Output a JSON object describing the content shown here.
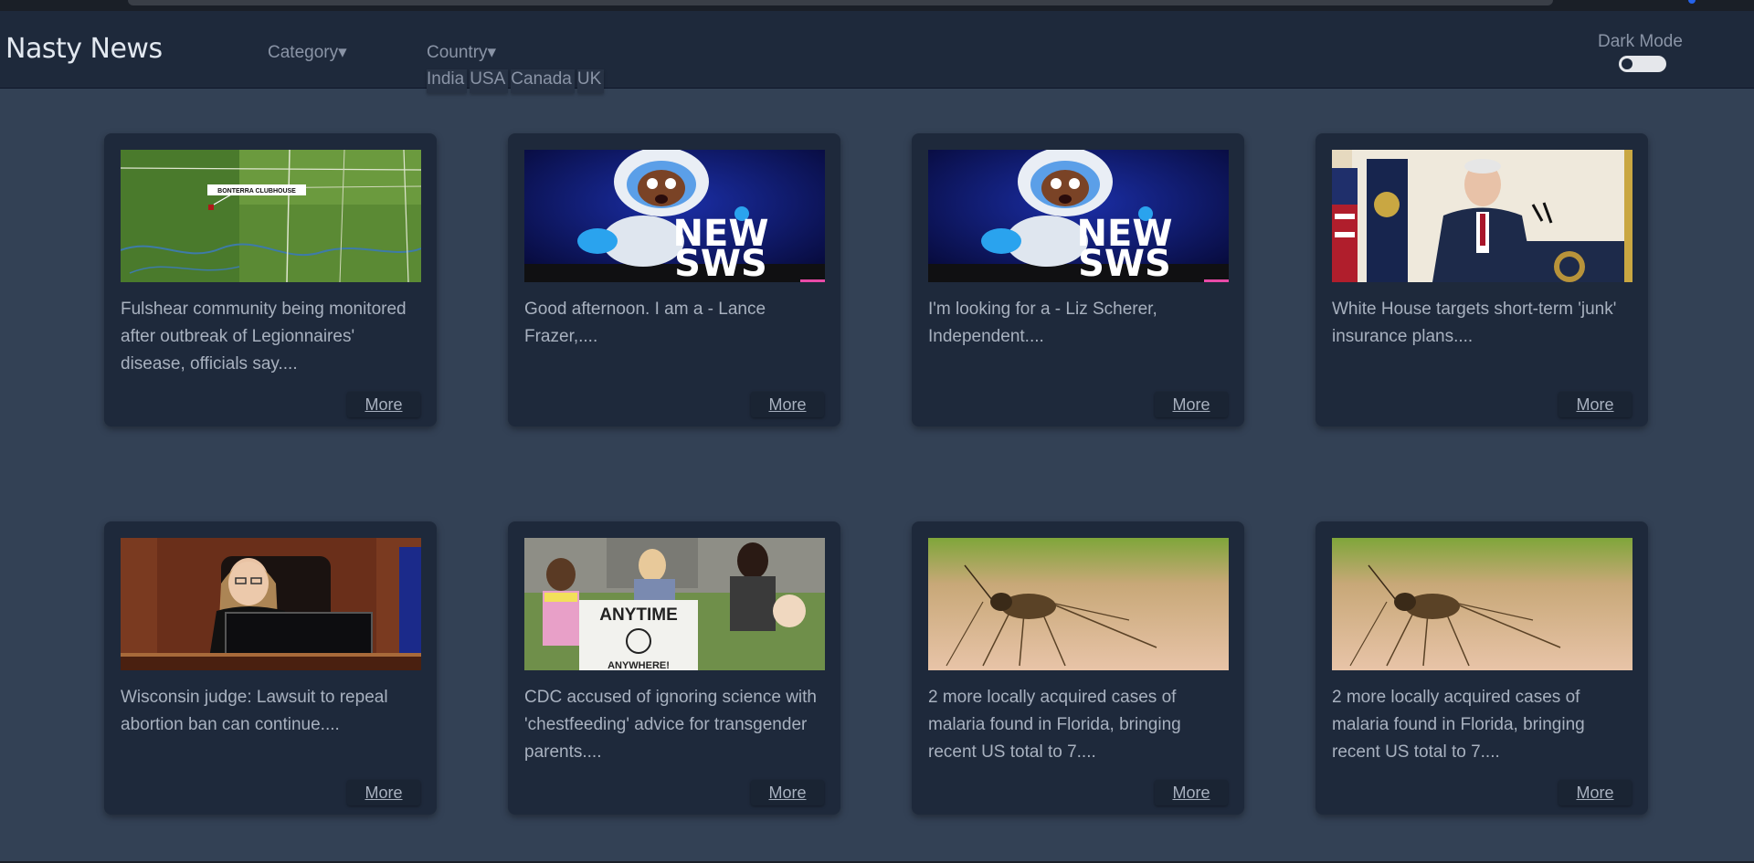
{
  "brand": "Nasty News",
  "nav": {
    "category_label": "Category▾",
    "country_label": "Country▾",
    "countries": [
      "India",
      "USA",
      "Canada",
      "UK"
    ]
  },
  "darkmode": {
    "label": "Dark Mode",
    "enabled": false
  },
  "colors": {
    "page_bg": "#334155",
    "navbar_bg": "#1e293b",
    "card_bg": "#1e293b",
    "text": "#a8b1bf"
  },
  "cards": [
    {
      "thumb": "map-thumbnail",
      "map_label": "BONTERRA CLUBHOUSE",
      "text": "Fulshear community being monitored after outbreak of Legionnaires' disease, officials say....",
      "more": "More"
    },
    {
      "thumb": "news-astronaut-thumbnail",
      "logo_text": [
        "NEW",
        "SWS"
      ],
      "text": "Good afternoon. I am a - Lance Frazer,....",
      "more": "More"
    },
    {
      "thumb": "news-astronaut-thumbnail",
      "logo_text": [
        "NEW",
        "SWS"
      ],
      "text": "I'm looking for a - Liz Scherer, Independent....",
      "more": "More"
    },
    {
      "thumb": "press-podium-thumbnail",
      "text": "White House targets short-term 'junk' insurance plans....",
      "more": "More"
    },
    {
      "thumb": "courtroom-judge-thumbnail",
      "text": "Wisconsin judge: Lawsuit to repeal abortion ban can continue....",
      "more": "More"
    },
    {
      "thumb": "protest-sign-thumbnail",
      "sign_text": [
        "ANYTIME",
        "ANYWHERE!"
      ],
      "text": "CDC accused of ignoring science with 'chestfeeding' advice for transgender parents....",
      "more": "More"
    },
    {
      "thumb": "mosquito-thumbnail",
      "text": "2 more locally acquired cases of malaria found in Florida, bringing recent US total to 7....",
      "more": "More"
    },
    {
      "thumb": "mosquito-thumbnail",
      "text": "2 more locally acquired cases of malaria found in Florida, bringing recent US total to 7....",
      "more": "More"
    }
  ]
}
